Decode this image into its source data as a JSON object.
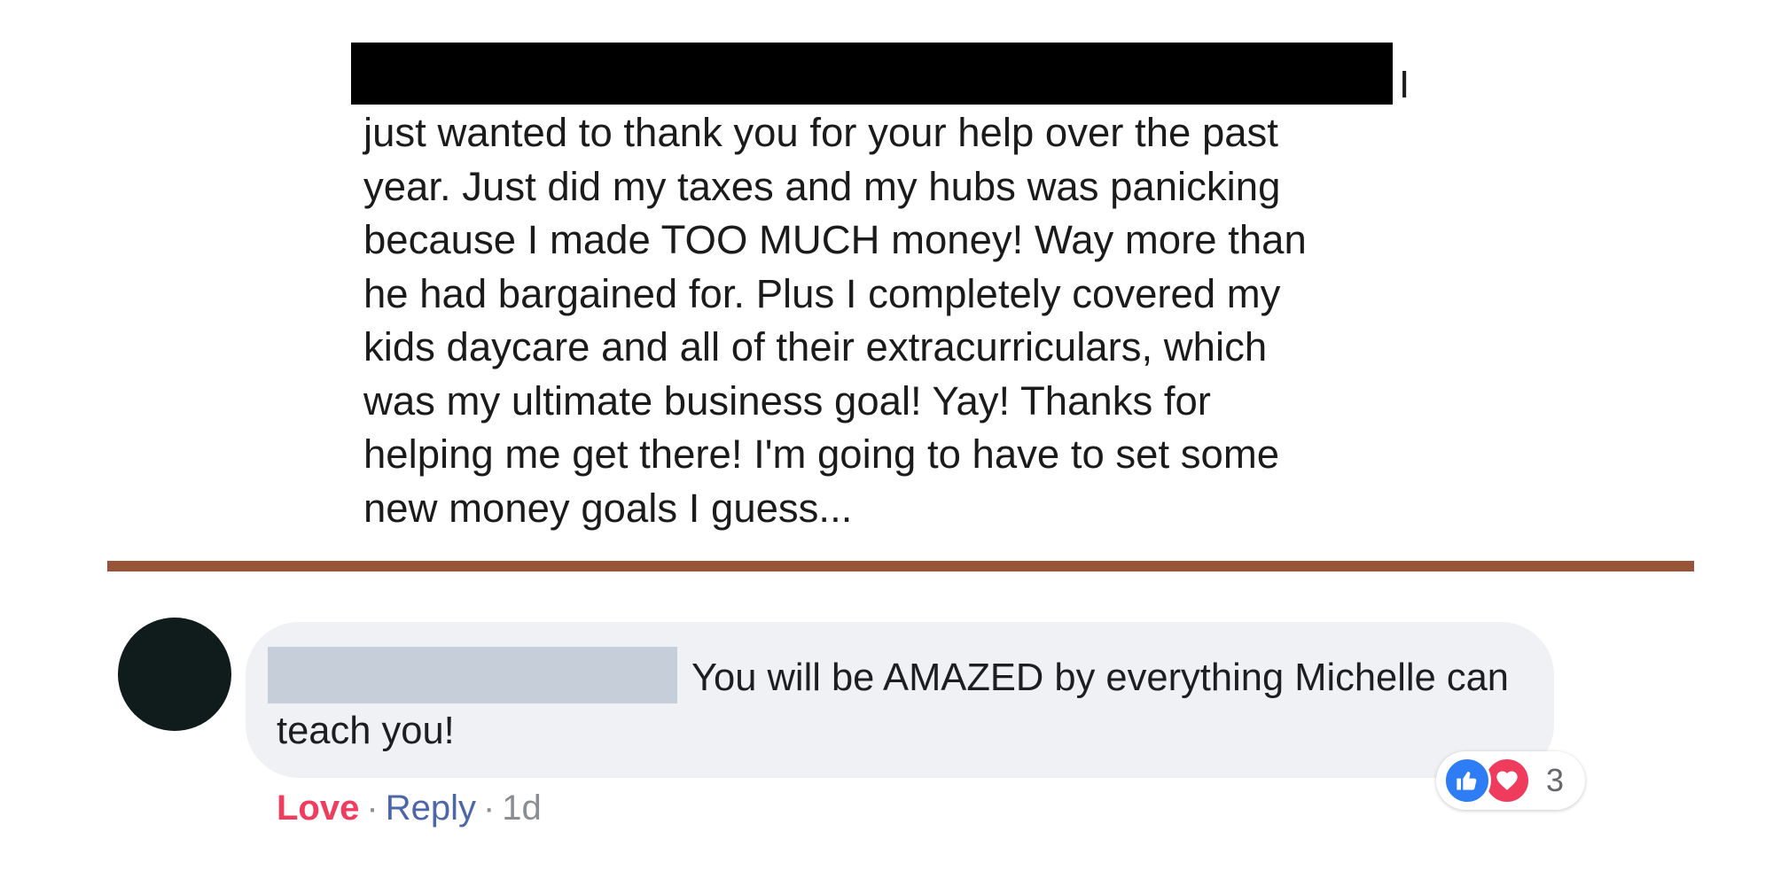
{
  "message": {
    "line_tail": "I",
    "body": "just wanted to thank you for your help over the past\nyear. Just did my taxes and my hubs was panicking\nbecause I made TOO MUCH money! Way more than\nhe had bargained for. Plus I completely covered my\nkids daycare and all of their extracurriculars, which\nwas my ultimate business goal! Yay! Thanks for\nhelping me get there! I'm going to have to set some\nnew money goals I guess..."
  },
  "comment": {
    "text": "You will be AMAZED by everything Michelle can teach you!",
    "reactions": {
      "icons": [
        "like-icon",
        "love-icon"
      ],
      "count": "3"
    },
    "actions": {
      "love_label": "Love",
      "reply_label": "Reply",
      "separator": "·",
      "timestamp": "1d"
    }
  },
  "colors": {
    "divider": "#985436",
    "love": "#f03d5f",
    "reply": "#4d66a8",
    "like_badge": "#2f7df5",
    "love_badge": "#ef3b5c",
    "bubble": "#eff1f4"
  }
}
